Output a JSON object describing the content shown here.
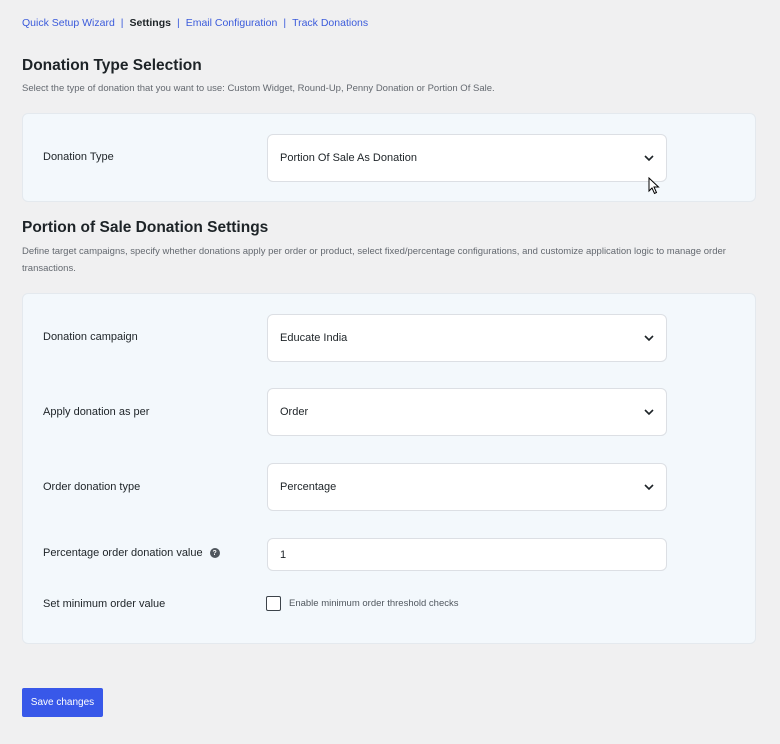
{
  "nav": {
    "items": [
      {
        "label": "Quick Setup Wizard",
        "current": false
      },
      {
        "label": "Settings",
        "current": true
      },
      {
        "label": "Email Configuration",
        "current": false
      },
      {
        "label": "Track Donations",
        "current": false
      }
    ],
    "separator": "|"
  },
  "type_section": {
    "title": "Donation Type Selection",
    "description": "Select the type of donation that you want to use: Custom Widget, Round-Up, Penny Donation or Portion Of Sale.",
    "donation_type_label": "Donation Type",
    "donation_type_value": "Portion Of Sale As Donation"
  },
  "pos_section": {
    "title": "Portion of Sale Donation Settings",
    "description": "Define target campaigns, specify whether donations apply per order or product, select fixed/percentage configurations, and customize application logic to manage order transactions.",
    "campaign_label": "Donation campaign",
    "campaign_value": "Educate India",
    "apply_label": "Apply donation as per",
    "apply_value": "Order",
    "order_type_label": "Order donation type",
    "order_type_value": "Percentage",
    "percentage_label": "Percentage order donation value",
    "percentage_value": "1",
    "min_order_label": "Set minimum order value",
    "min_order_checkbox_label": "Enable minimum order threshold checks",
    "min_order_checked": false
  },
  "footer": {
    "save_label": "Save changes"
  },
  "colors": {
    "accent": "#3858e9",
    "link": "#3b5bdb",
    "card_bg": "#f3f8fc",
    "page_bg": "#f0f0f1"
  },
  "icons": {
    "select_chevron": "chevron-down-icon",
    "help": "question-circle-icon",
    "cursor": "mouse-pointer-icon"
  }
}
